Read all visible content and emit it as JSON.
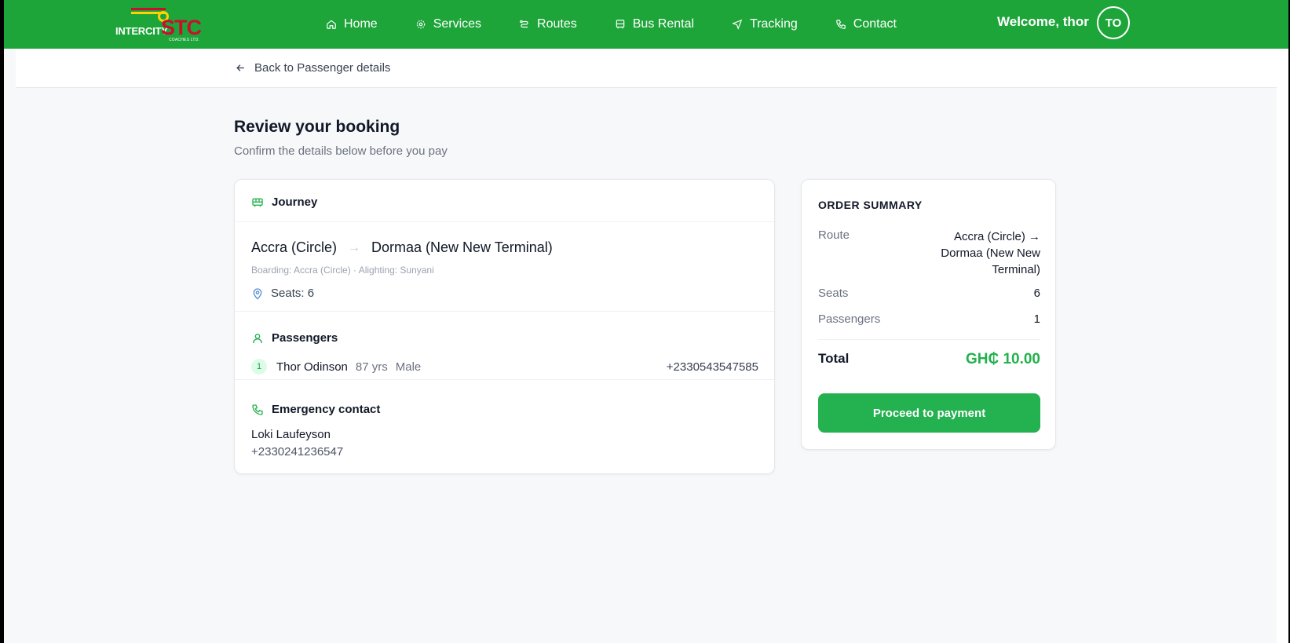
{
  "brand": {
    "logo_word_a": "INTERCITY",
    "logo_word_b": "STC",
    "logo_word_c": "COACHES LTD."
  },
  "nav": {
    "items": [
      {
        "label": "Home",
        "icon": "home-icon"
      },
      {
        "label": "Services",
        "icon": "gear-icon"
      },
      {
        "label": "Routes",
        "icon": "route-icon"
      },
      {
        "label": "Bus Rental",
        "icon": "bus-icon"
      },
      {
        "label": "Tracking",
        "icon": "navigation-icon"
      },
      {
        "label": "Contact",
        "icon": "phone-icon"
      }
    ],
    "welcome": "Welcome, thor",
    "avatar_initials": "TO"
  },
  "back": {
    "label": "Back to Passenger details"
  },
  "page": {
    "title": "Review your booking",
    "subtitle": "Confirm the details below before you pay"
  },
  "journey": {
    "heading": "Journey",
    "from": "Accra (Circle)",
    "arrow": "→",
    "to": "Dormaa (New New Terminal)",
    "boarding": "Boarding: Accra (Circle) · Alighting: Sunyani",
    "seats": "Seats: 6"
  },
  "passengers": {
    "heading": "Passengers",
    "list": [
      {
        "num": "1",
        "name": "Thor Odinson",
        "age": "87 yrs",
        "sex": "Male",
        "phone": "+2330543547585"
      }
    ]
  },
  "emergency": {
    "heading": "Emergency contact",
    "name": "Loki Laufeyson",
    "phone": "+2330241236547"
  },
  "summary": {
    "title": "ORDER SUMMARY",
    "route_label": "Route",
    "route_value": "Accra (Circle) → Dormaa (New New Terminal)",
    "seats_label": "Seats",
    "seats_value": "6",
    "passengers_label": "Passengers",
    "passengers_value": "1",
    "total_label": "Total",
    "total_value": "GH₵ 10.00",
    "pay_button": "Proceed to payment"
  },
  "colors": {
    "header_green": "#1ea53a",
    "accent_green": "#22b14c",
    "logo_red": "#c8102e",
    "logo_yellow": "#ffd200"
  }
}
